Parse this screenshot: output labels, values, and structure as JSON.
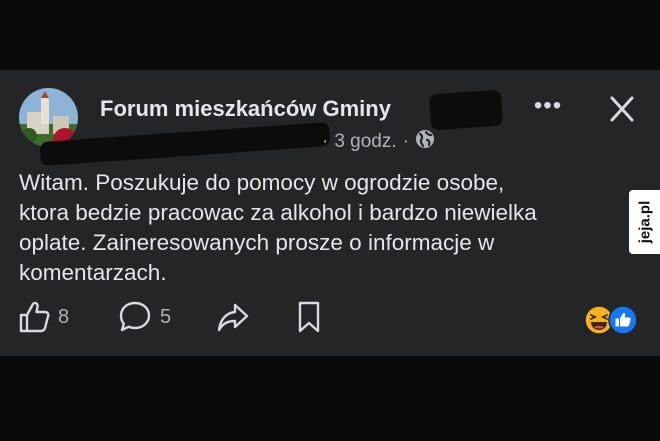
{
  "post": {
    "group_name": "Forum mieszkańców Gminy",
    "meta_time": "3 godz.",
    "meta_separator": "·",
    "text_lines": [
      "Witam. Poszukuje do pomocy w ogrodzie osobe,",
      "ktora bedzie pracowac za alkohol i bardzo niewielka",
      "oplate. Zaineresowanych prosze o informacje w",
      "komentarzach."
    ]
  },
  "header": {
    "more_label": "•••"
  },
  "actions": {
    "like_count": "8",
    "comment_count": "5"
  },
  "watermark": {
    "text": "jeja.pl"
  },
  "icons": {
    "avatar": "group-avatar",
    "globe": "globe-icon",
    "like": "thumbs-up-icon",
    "comment": "comment-bubble-icon",
    "share": "share-arrow-icon",
    "save": "bookmark-icon",
    "close": "close-icon"
  },
  "colors": {
    "background": "#0a0a0a",
    "post_background": "#242526",
    "primary_text": "#e4e6eb",
    "secondary_text": "#b0b3b8",
    "like_blue": "#1877f2",
    "haha_yellow": "#f7b125"
  }
}
